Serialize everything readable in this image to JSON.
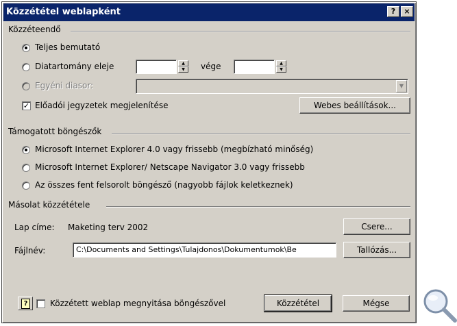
{
  "window": {
    "title": "Közzététel weblapként",
    "help_btn": "?",
    "close_btn": "×"
  },
  "publish_group": {
    "label": "Közzéteendő",
    "opt_full": "Teljes bemutató",
    "opt_range": "Diatartomány eleje",
    "range_start": "",
    "range_end_label": "vége",
    "range_end": "",
    "opt_custom": "Egyéni diasor:",
    "custom_value": "",
    "notes_checkbox": "Előadói jegyzetek megjelenítése",
    "notes_checked": true,
    "web_options_button": "Webes beállítások..."
  },
  "browsers_group": {
    "label": "Támogatott böngészők",
    "opt_ie4": "Microsoft Internet Explorer 4.0 vagy frissebb (megbízható minőség)",
    "opt_ie3": "Microsoft Internet Explorer/ Netscape Navigator 3.0 vagy frissebb",
    "opt_all": "Az összes fent felsorolt böngésző (nagyobb fájlok keletkeznek)"
  },
  "copy_group": {
    "label": "Másolat közzététele",
    "page_title_label": "Lap címe:",
    "page_title_value": "Maketing terv 2002",
    "change_button": "Csere...",
    "filename_label": "Fájlnév:",
    "filename_value": "C:\\Documents and Settings\\Tulajdonos\\Dokumentumok\\Be",
    "browse_button": "Tallózás..."
  },
  "footer": {
    "open_checkbox": "Közzétett weblap megnyitása böngészővel",
    "open_checked": false,
    "publish_button": "Közzététel",
    "cancel_button": "Mégse"
  },
  "icons": {
    "help": "help-book-icon",
    "magnifier": "magnifier-icon"
  }
}
